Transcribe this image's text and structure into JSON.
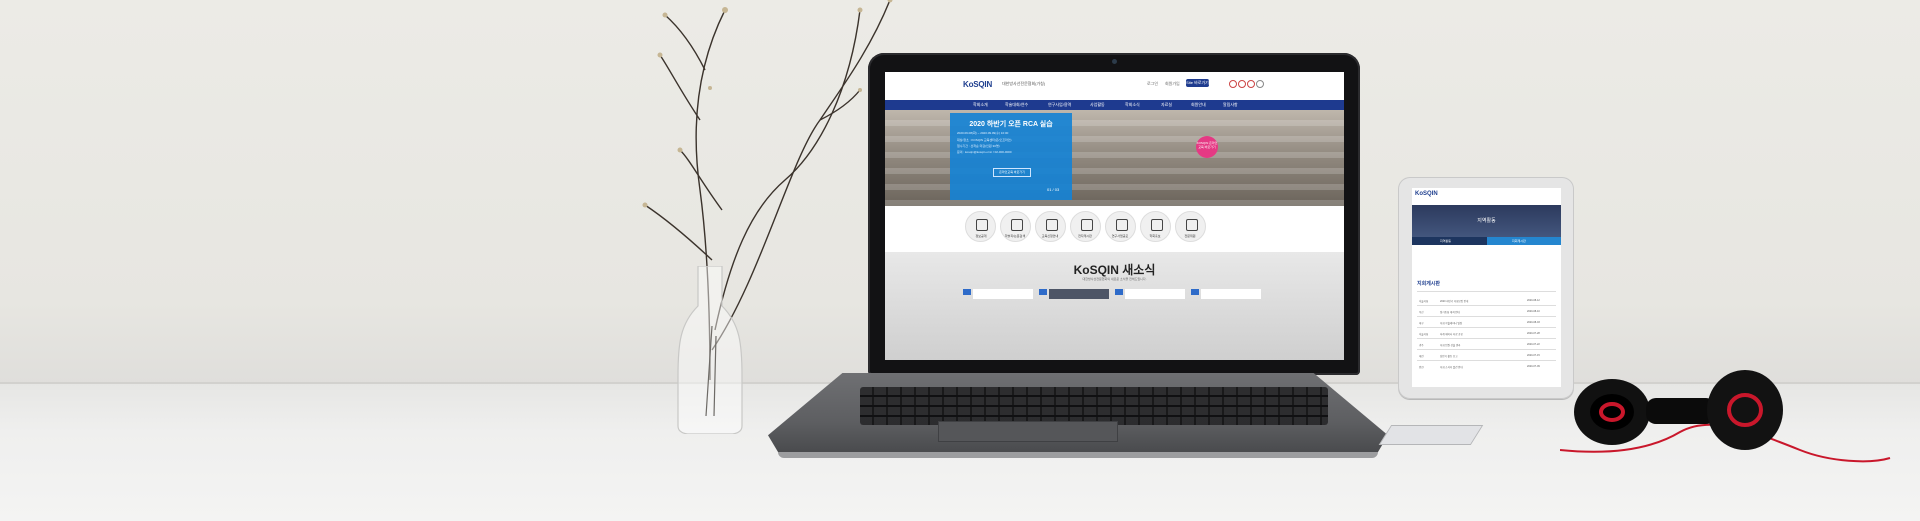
{
  "site": {
    "logo": "KoSQIN",
    "logo_sub": "대한방사선전문협회(가칭)",
    "top_links": [
      "로그인",
      "회원가입"
    ],
    "top_button": "Site 바로가기",
    "nav": [
      "학회소개",
      "학술대회/연수",
      "연구사업/용역",
      "사업활동",
      "학회소식",
      "자료실",
      "회원안내",
      "알림사항"
    ]
  },
  "hero": {
    "title": "2020 하반기 오픈 RCA 실습",
    "lines": [
      "2020.09.08(화) ~ 2020.09.09(수) 10:00",
      "대상/장소 : KOSQIN 교육센터(온/오프라인)",
      "접수기간 : 선착순 마감(인원 30명)",
      "문의 : kosqin@kosqin.or.kr / 02-000-0000"
    ],
    "button": "온라인교육 바로가기",
    "pagination": "01 / 03",
    "badge": "KOSQIN 온라인교육 바로가기"
  },
  "quick_links": [
    "정보공개",
    "학술지/논문검색",
    "교육신청안내",
    "전자게시판",
    "연구사업공모",
    "학회홍보",
    "전문위원"
  ],
  "news": {
    "title": "KoSQIN 새소식",
    "subtitle": "대한방사선전문협회의 새로운 소식을 전해드립니다."
  },
  "tablet": {
    "logo": "KoSQIN",
    "banner_title": "지역활동",
    "tabs": [
      "지역활동",
      "지회게시판"
    ],
    "section": "지회게시판",
    "rows": [
      [
        "서울지회",
        "2020 하반기 지회모임 안내",
        "2020-08-12"
      ],
      [
        "부산",
        "정기총회 개최 안내",
        "2020-08-10"
      ],
      [
        "대구",
        "지회 학술세미나 일정",
        "2020-08-03"
      ],
      [
        "서울지회",
        "하계 세미나 자료 공유",
        "2020-07-28"
      ],
      [
        "광주",
        "지회 임원 선출 결과",
        "2020-07-22"
      ],
      [
        "대전",
        "상반기 활동 보고",
        "2020-07-15"
      ],
      [
        "인천",
        "지회 소식지 발간 안내",
        "2020-07-09"
      ]
    ]
  },
  "colors": {
    "brand_navy": "#1e3a8f",
    "hero_blue": "#1682d4",
    "accent_pink": "#e53984",
    "accent_red": "#d32f2f"
  }
}
